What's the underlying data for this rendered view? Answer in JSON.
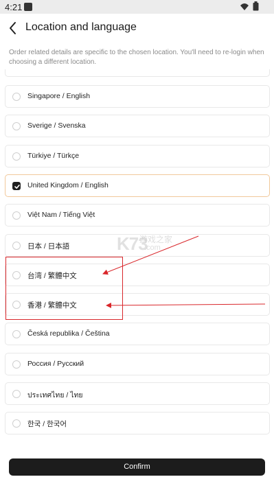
{
  "status_bar": {
    "time": "4:21",
    "icons": [
      "notification-icon",
      "wifi-icon",
      "battery-icon"
    ]
  },
  "header": {
    "title": "Location and language",
    "back_icon": "chevron-left-icon"
  },
  "notice": "Order related details are specific to the chosen location. You'll need to re-login when choosing a different location.",
  "locations": [
    {
      "label": "Singapore / English",
      "selected": false
    },
    {
      "label": "Sverige / Svenska",
      "selected": false
    },
    {
      "label": "Türkiye / Türkçe",
      "selected": false
    },
    {
      "label": "United Kingdom / English",
      "selected": true
    },
    {
      "label": "Việt Nam / Tiếng Việt",
      "selected": false
    },
    {
      "label": "日本 / 日本語",
      "selected": false
    },
    {
      "label": "台湾 / 繁體中文",
      "selected": false
    },
    {
      "label": "香港 / 繁體中文",
      "selected": false
    },
    {
      "label": "Česká republika / Čeština",
      "selected": false
    },
    {
      "label": "Россия / Русский",
      "selected": false
    },
    {
      "label": "ประเทศไทย / ไทย",
      "selected": false
    },
    {
      "label": "한국 / 한국어",
      "selected": false
    }
  ],
  "confirm_label": "Confirm",
  "watermark": {
    "main": "K73",
    "sub_cn": "游戏之家",
    "sub": ".com"
  },
  "colors": {
    "selected_border": "#f1c89a",
    "annotation_red": "#d9262a",
    "button_bg": "#1c1c1c"
  }
}
